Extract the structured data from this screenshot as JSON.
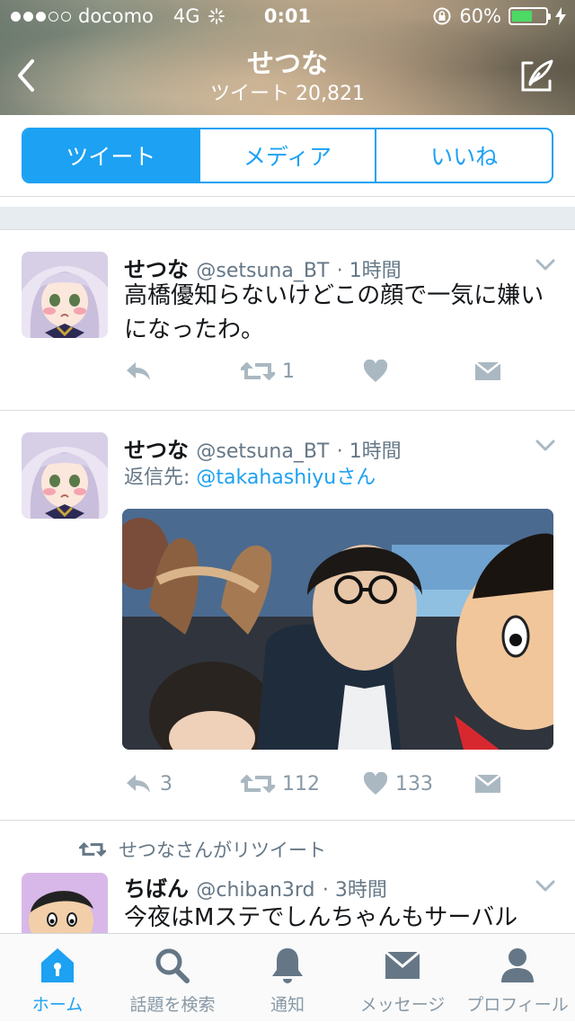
{
  "status_bar": {
    "carrier": "docomo",
    "network": "4G",
    "time": "0:01",
    "battery": "60%",
    "battery_level": 0.6
  },
  "header": {
    "title": "せつな",
    "subtitle": "ツイート 20,821"
  },
  "tabs": [
    {
      "label": "ツイート",
      "active": true
    },
    {
      "label": "メディア",
      "active": false
    },
    {
      "label": "いいね",
      "active": false
    }
  ],
  "tweets": [
    {
      "name": "せつな",
      "handle": "@setsuna_BT",
      "time": "· 1時間",
      "text": "高橋優知らないけどこの顔で一気に嫌いになったわ。",
      "reply_count": "",
      "retweet_count": "1",
      "like_count": ""
    },
    {
      "name": "せつな",
      "handle": "@setsuna_BT",
      "time": "· 1時間",
      "reply_prefix": "返信先: ",
      "reply_to": "@takahashiyu",
      "reply_suffix": "さん",
      "reply_count": "3",
      "retweet_count": "112",
      "like_count": "133"
    },
    {
      "retweeted_by": "せつなさんがリツイート",
      "name": "ちばん",
      "handle": "@chiban3rd",
      "time": "· 3時間",
      "text": "今夜はMステでしんちゃんもサーバル"
    }
  ],
  "tabbar": [
    {
      "label": "ホーム",
      "icon": "home-icon",
      "active": true
    },
    {
      "label": "話題を検索",
      "icon": "search-icon",
      "active": false
    },
    {
      "label": "通知",
      "icon": "bell-icon",
      "active": false
    },
    {
      "label": "メッセージ",
      "icon": "envelope-icon",
      "active": false
    },
    {
      "label": "プロフィール",
      "icon": "person-icon",
      "active": false
    }
  ],
  "colors": {
    "accent": "#1da1f2",
    "muted": "#8899a6",
    "battery": "#4cd964"
  }
}
